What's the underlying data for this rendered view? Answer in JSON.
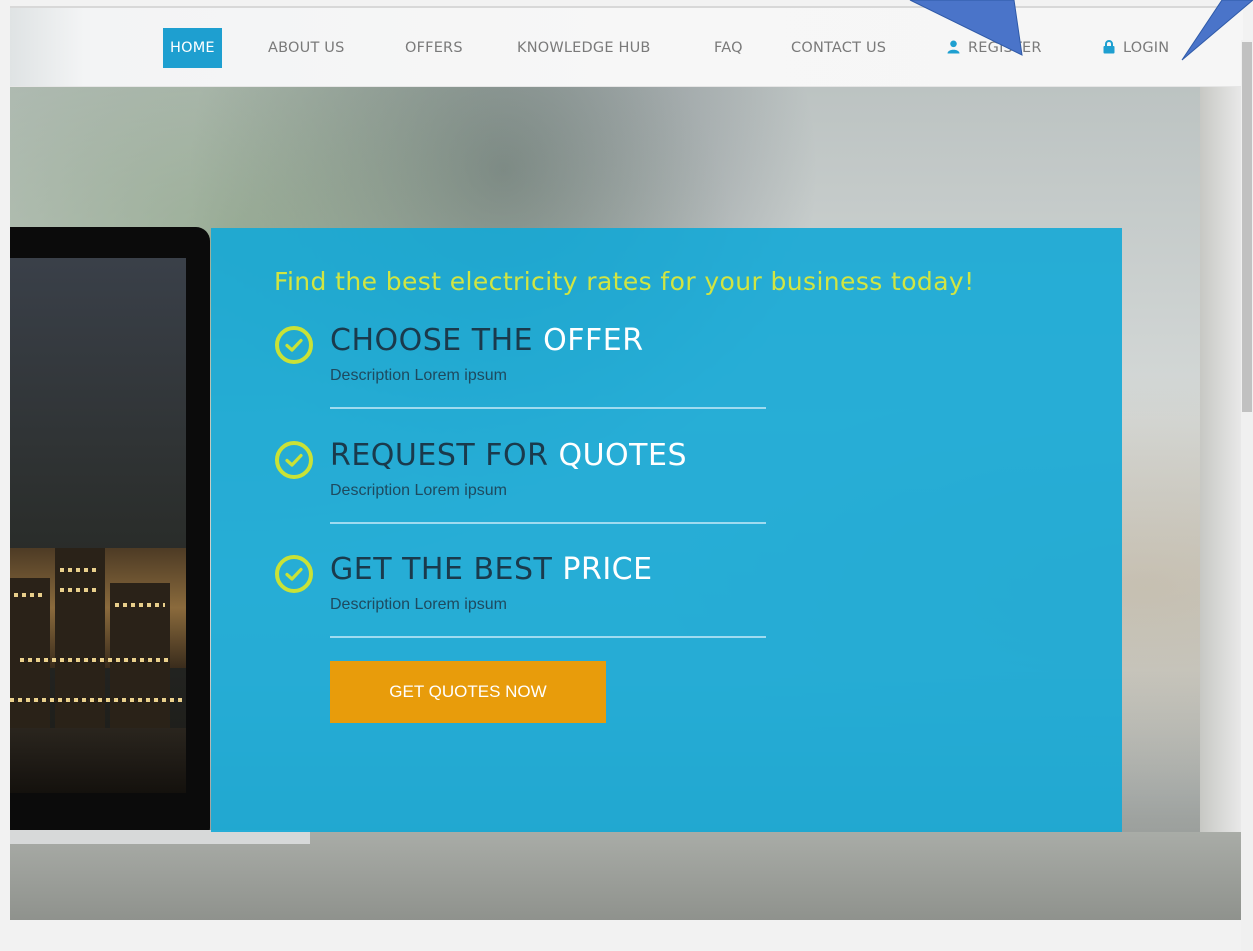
{
  "nav": {
    "items": [
      {
        "label": "HOME",
        "active": true
      },
      {
        "label": "ABOUT US"
      },
      {
        "label": "OFFERS"
      },
      {
        "label": "KNOWLEDGE HUB"
      },
      {
        "label": "FAQ"
      },
      {
        "label": "CONTACT US"
      },
      {
        "label": "REGISTER",
        "icon": "user-icon"
      },
      {
        "label": "LOGIN",
        "icon": "lock-icon"
      }
    ],
    "active_color": "#1e9fd0"
  },
  "hero": {
    "tagline": "Find the best electricity rates for your business today!",
    "steps": [
      {
        "title_pre": "CHOOSE THE ",
        "title_hl": "OFFER",
        "desc": "Description Lorem ipsum",
        "icon": "check-circle-icon"
      },
      {
        "title_pre": "REQUEST FOR ",
        "title_hl": "QUOTES",
        "desc": "Description Lorem ipsum",
        "icon": "check-circle-icon"
      },
      {
        "title_pre": "GET THE BEST ",
        "title_hl": "PRICE",
        "desc": "Description Lorem ipsum",
        "icon": "check-circle-icon"
      }
    ],
    "cta_label": "GET QUOTES NOW",
    "panel_color": "#14a8d6",
    "accent_color": "#d1e542",
    "cta_color": "#e89c0b"
  }
}
